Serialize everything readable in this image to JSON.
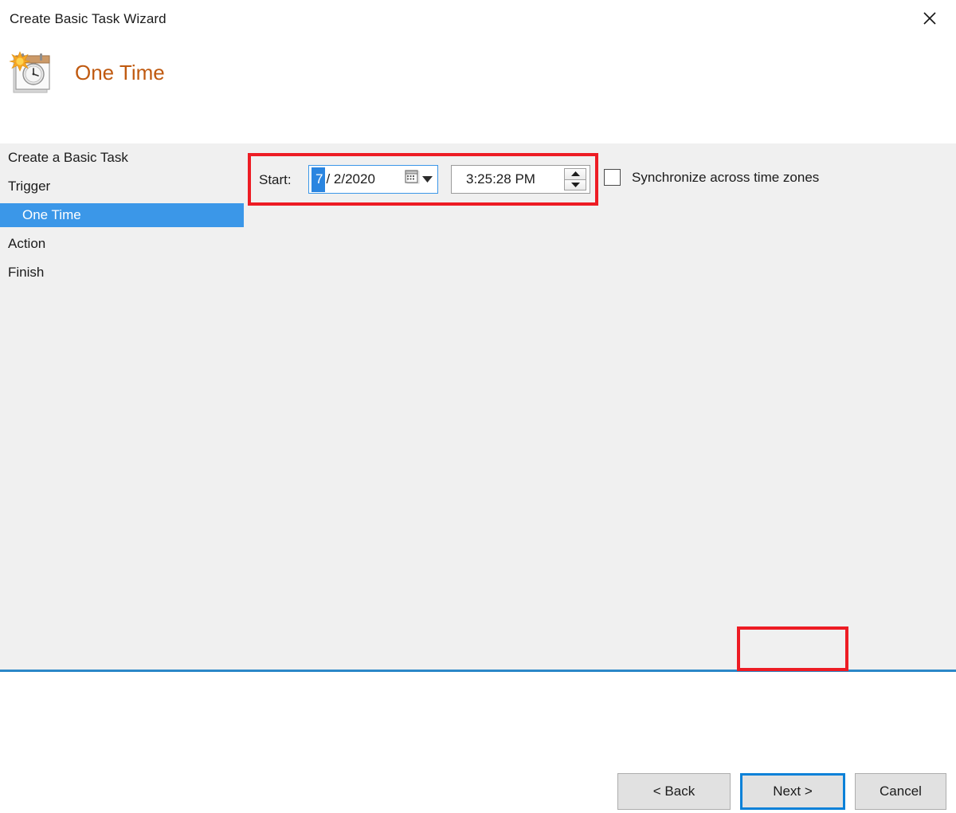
{
  "window": {
    "title": "Create Basic Task Wizard",
    "close_icon": "close-icon"
  },
  "header": {
    "icon": "one-time-calendar-clock-icon",
    "heading": "One Time"
  },
  "sidebar": {
    "items": [
      {
        "label": "Create a Basic Task",
        "selected": false,
        "sub": false
      },
      {
        "label": "Trigger",
        "selected": false,
        "sub": false
      },
      {
        "label": "One Time",
        "selected": true,
        "sub": true
      },
      {
        "label": "Action",
        "selected": false,
        "sub": false
      },
      {
        "label": "Finish",
        "selected": false,
        "sub": false
      }
    ]
  },
  "main": {
    "start_label": "Start:",
    "date": {
      "selected_segment": "7",
      "rest": "/  2/2020",
      "full_value": "7/ 2/2020",
      "dropdown_icon": "calendar-icon",
      "chevron_icon": "chevron-down-icon"
    },
    "time": {
      "value": "3:25:28 PM",
      "spinner_up_icon": "spinner-up-icon",
      "spinner_down_icon": "spinner-down-icon"
    },
    "sync": {
      "label": "Synchronize across time zones",
      "checked": false
    }
  },
  "footer": {
    "back_label": "< Back",
    "next_label": "Next >",
    "cancel_label": "Cancel"
  },
  "colors": {
    "accent_blue": "#3b97e8",
    "focus_blue": "#0b81d8",
    "annotation_red": "#ed1c24",
    "heading_orange": "#c05a10",
    "body_gray": "#f0f0f0",
    "bottom_border_blue": "#2b87c8"
  }
}
